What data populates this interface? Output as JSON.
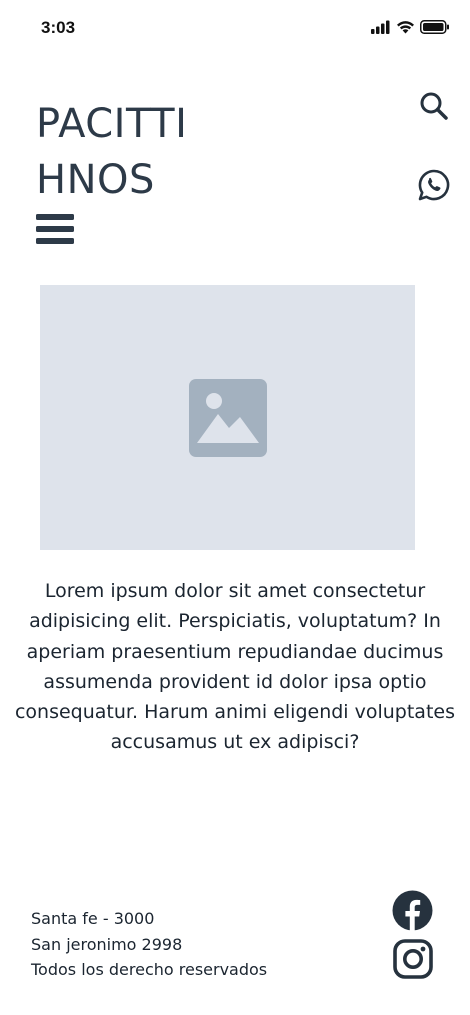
{
  "status_bar": {
    "time": "3:03"
  },
  "brand": {
    "line1": "PACITTI",
    "line2": "HNOS"
  },
  "header": {
    "search_icon": "search-icon",
    "whatsapp_icon": "whatsapp-icon",
    "menu_icon": "hamburger-menu-icon"
  },
  "main": {
    "image_placeholder_icon": "image-placeholder-icon",
    "paragraph": "Lorem ipsum dolor sit amet consectetur adipisicing elit. Perspiciatis, voluptatum? In aperiam praesentium repudiandae ducimus assumenda provident id dolor ipsa optio consequatur. Harum animi eligendi voluptates accusamus ut ex adipisci?"
  },
  "footer": {
    "address_line1": "Santa fe - 3000",
    "address_line2": "San jeronimo 2998",
    "rights": "Todos los derecho reservados",
    "facebook_icon": "facebook-icon",
    "instagram_icon": "instagram-icon"
  },
  "colors": {
    "text": "#26323e",
    "placeholder_bg": "#dee3eb",
    "placeholder_icon": "#a3b1bf"
  }
}
